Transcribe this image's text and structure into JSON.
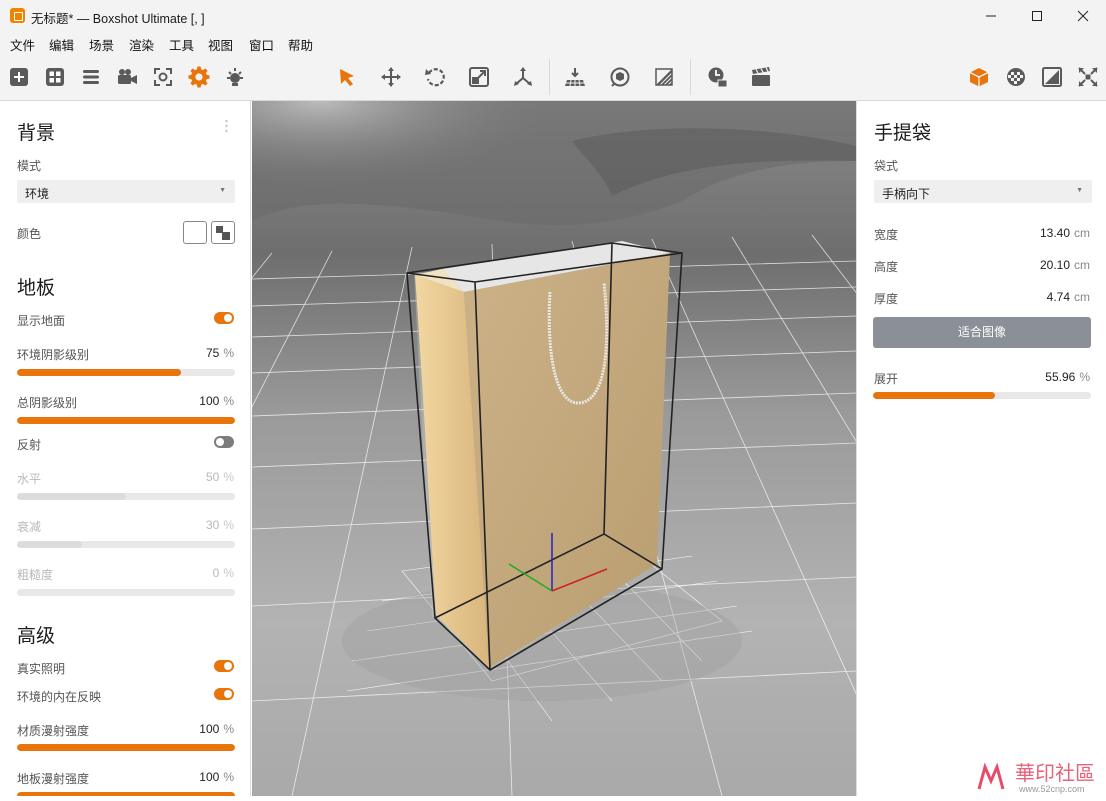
{
  "window": {
    "title": "无标题* — Boxshot Ultimate [, ]",
    "controls": {
      "minimize": "minimize-icon",
      "maximize": "maximize-icon",
      "close": "close-icon"
    }
  },
  "menu": [
    "文件",
    "编辑",
    "场景",
    "渲染",
    "工具",
    "视图",
    "窗口",
    "帮助"
  ],
  "toolbar": {
    "left_icons": [
      "add-icon",
      "grid-icon",
      "list-icon",
      "camera-icon",
      "focus-icon",
      "settings-icon",
      "light-icon"
    ],
    "center_icons": [
      "select-arrow-icon",
      "move-icon",
      "rotate-icon",
      "scale-icon",
      "pivot-icon",
      "floor-align-icon",
      "orbit-icon",
      "texture-icon",
      "time-icon",
      "clapper-icon"
    ],
    "right_icons": [
      "box-icon",
      "material-icon",
      "view-icon",
      "fullscreen-icon"
    ],
    "accent": "#e8740c"
  },
  "left_panel": {
    "background": {
      "heading": "背景",
      "mode_label": "模式",
      "mode_value": "环境",
      "color_label": "颜色"
    },
    "floor": {
      "heading": "地板",
      "show_floor_label": "显示地面",
      "show_floor": true,
      "env_shadow_label": "环境阴影级别",
      "env_shadow_value": "75",
      "env_shadow": 75,
      "total_shadow_label": "总阴影级别",
      "total_shadow_value": "100",
      "total_shadow": 100,
      "reflection_label": "反射",
      "reflection": false,
      "level_label": "水平",
      "level_value": "50",
      "level": 50,
      "falloff_label": "衰减",
      "falloff_value": "30",
      "falloff": 30,
      "roughness_label": "粗糙度",
      "roughness_value": "0",
      "roughness": 0
    },
    "advanced": {
      "heading": "高级",
      "realistic_label": "真实照明",
      "realistic": true,
      "env_reflect_label": "环境的内在反映",
      "env_reflect": true,
      "material_diffuse_label": "材质漫射强度",
      "material_diffuse_value": "100",
      "material_diffuse": 100,
      "floor_diffuse_label": "地板漫射强度",
      "floor_diffuse_value": "100",
      "floor_diffuse": 100
    },
    "percent_unit": "%"
  },
  "right_panel": {
    "heading": "手提袋",
    "type_label": "袋式",
    "type_value": "手柄向下",
    "width_label": "宽度",
    "width_value": "13.40",
    "height_label": "高度",
    "height_value": "20.10",
    "depth_label": "厚度",
    "depth_value": "4.74",
    "unit_cm": "cm",
    "fit_button": "适合图像",
    "unfold_label": "展开",
    "unfold_value": "55.96",
    "unfold": 55.96,
    "percent_unit": "%"
  },
  "watermark": {
    "text": "華印社區",
    "url_text": "www.52cnp.com"
  }
}
